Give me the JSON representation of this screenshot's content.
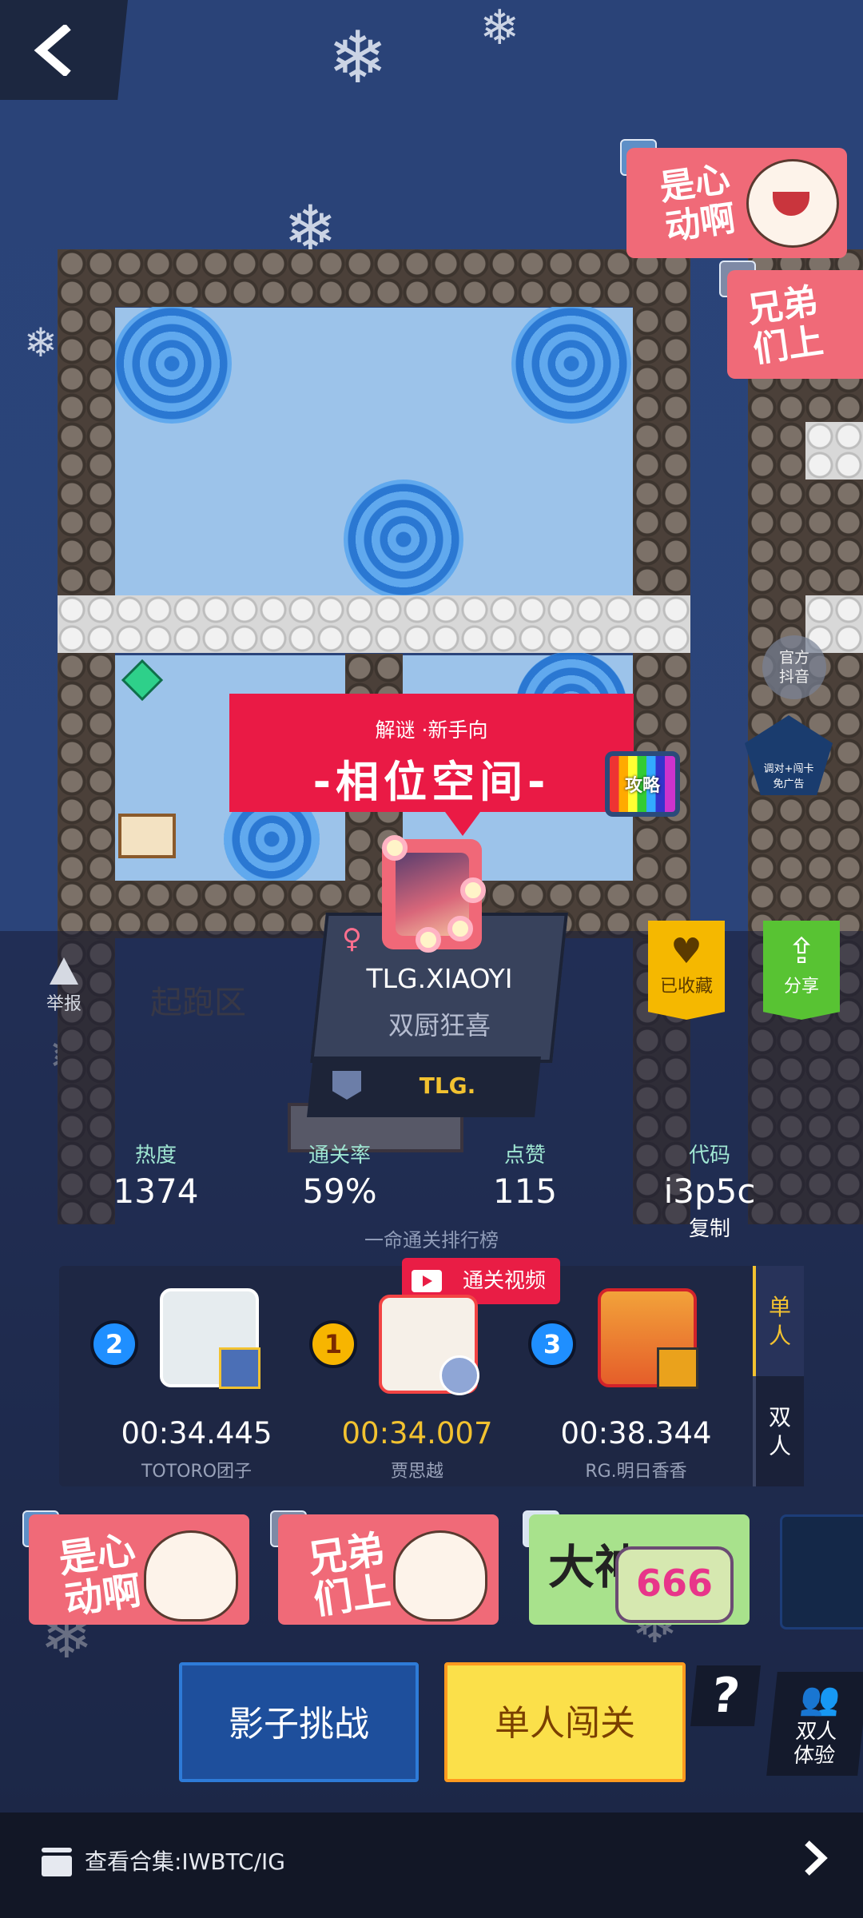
{
  "nav": {
    "back_icon": "back-chevron-icon"
  },
  "stickers_top": [
    {
      "text": "是心\n动啊"
    },
    {
      "text": "兄弟\n们上"
    }
  ],
  "level": {
    "tags": "解谜 ·新手向",
    "name": "-相位空间-",
    "guide_label": "攻略"
  },
  "side": {
    "official_label": "官方\n抖音",
    "promo_label": "调对+闯卡\n免广告"
  },
  "map": {
    "start_zone_label": "起跑区"
  },
  "author": {
    "gender_icon": "female-icon",
    "name": "TLG.XIAOYI",
    "title": "双厨狂喜",
    "team": "TLG."
  },
  "actions": {
    "report_label": "举报",
    "favorite_label": "已收藏",
    "share_label": "分享"
  },
  "stats": [
    {
      "label": "热度",
      "value": "1374"
    },
    {
      "label": "通关率",
      "value": "59%"
    },
    {
      "label": "点赞",
      "value": "115"
    },
    {
      "label": "代码",
      "value": "i3p5c"
    }
  ],
  "copy_label": "复制",
  "leaderboard": {
    "title": "一命通关排行榜",
    "video_label": "通关视频",
    "tabs": [
      "单\n人",
      "双\n人"
    ],
    "entries": [
      {
        "rank": "2",
        "time": "00:34.445",
        "name": "TOTORO团子"
      },
      {
        "rank": "1",
        "time": "00:34.007",
        "name": "贾思越"
      },
      {
        "rank": "3",
        "time": "00:38.344",
        "name": "RG.明日香香"
      }
    ]
  },
  "emotes": [
    {
      "text": "是心\n动啊"
    },
    {
      "text": "兄弟\n们上"
    },
    {
      "text": "大神",
      "extra": "666"
    }
  ],
  "buttons": {
    "shadow": "影子挑战",
    "single": "单人闯关",
    "help": "?",
    "duo": "双人\n体验"
  },
  "footer": {
    "collection": "查看合集:IWBTC/IG"
  },
  "colors": {
    "accent_red": "#ea1a45",
    "gold": "#f2c230",
    "teal_label": "#9fe6d2",
    "favorite": "#f5b800",
    "share": "#58c333"
  }
}
